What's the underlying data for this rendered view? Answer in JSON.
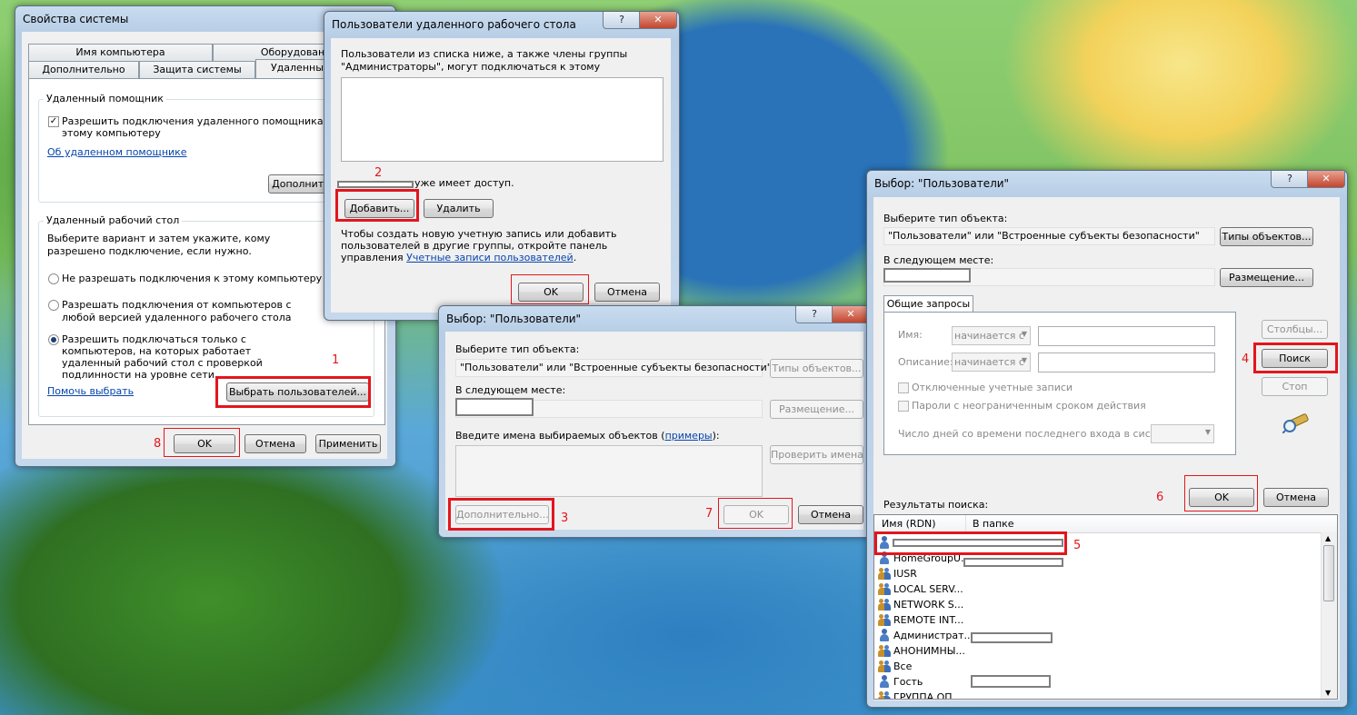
{
  "sys": {
    "title": "Свойства системы",
    "tabs_top": [
      "Имя компьютера",
      "Оборудование"
    ],
    "tabs_bottom": [
      "Дополнительно",
      "Защита системы",
      "Удаленный доступ"
    ],
    "assist_group": "Удаленный помощник",
    "assist_check": "Разрешить подключения удаленного помощника к этому компьютеру",
    "assist_link": "Об удаленном помощнике",
    "advanced_btn": "Дополнительно...",
    "desk_group": "Удаленный рабочий стол",
    "desk_desc": "Выберите вариант и затем укажите, кому разрешено подключение, если нужно.",
    "radio1": "Не разрешать подключения к этому компьютеру",
    "radio2": "Разрешать подключения от компьютеров с любой версией удаленного рабочего стола (опаснее)",
    "radio3": "Разрешить подключаться только с компьютеров, на которых работает удаленный рабочий стол с проверкой подлинности на уровне сети",
    "help_link": "Помочь выбрать",
    "select_users_btn": "Выбрать пользователей...",
    "ok": "OK",
    "cancel": "Отмена",
    "apply": "Применить"
  },
  "rdu": {
    "title": "Пользователи удаленного рабочего стола",
    "help_glyph": "?",
    "close_glyph": "✕",
    "desc": "Пользователи из списка ниже, а также члены группы \"Администраторы\", могут подключаться к этому компьютеру.",
    "access": "уже имеет доступ.",
    "add": "Добавить...",
    "remove": "Удалить",
    "hint": "Чтобы создать новую учетную запись или добавить пользователей в другие группы, откройте панель управления",
    "hint_link": "Учетные записи пользователей",
    "ok": "OK",
    "cancel": "Отмена"
  },
  "sel1": {
    "title": "Выбор: \"Пользователи\"",
    "obj_label": "Выберите тип объекта:",
    "obj_value": "\"Пользователи\" или \"Встроенные субъекты безопасности\"",
    "types_btn": "Типы объектов...",
    "loc_label": "В следующем месте:",
    "loc_btn": "Размещение...",
    "names_label": "Введите имена выбираемых объектов (",
    "names_link": "примеры",
    "names_label_end": "):",
    "check_btn": "Проверить имена",
    "advanced_btn": "Дополнительно...",
    "ok": "OK",
    "cancel": "Отмена"
  },
  "sel2": {
    "title": "Выбор: \"Пользователи\"",
    "obj_label": "Выберите тип объекта:",
    "obj_value": "\"Пользователи\" или \"Встроенные субъекты безопасности\"",
    "types_btn": "Типы объектов...",
    "loc_label": "В следующем месте:",
    "loc_btn": "Размещение...",
    "tab": "Общие запросы",
    "name_label": "Имя:",
    "desc_label": "Описание:",
    "starts_with": "начинается с",
    "disabled_check": "Отключенные учетные записи",
    "noexpire_check": "Пароли с неограниченным сроком действия",
    "days_label": "Число дней со времени последнего входа в систему:",
    "columns_btn": "Столбцы...",
    "search_btn": "Поиск",
    "stop_btn": "Стоп",
    "ok": "OK",
    "cancel": "Отмена",
    "results_label": "Результаты поиска:",
    "col_name": "Имя (RDN)",
    "col_folder": "В папке",
    "results": [
      "",
      "HomeGroupU...",
      "IUSR",
      "LOCAL SERV...",
      "NETWORK S...",
      "REMOTE INT...",
      "Администрат...",
      "АНОНИМНЫ...",
      "Все",
      "Гость",
      "ГРУППА ОП..."
    ]
  },
  "annotations": [
    "1",
    "2",
    "3",
    "4",
    "5",
    "6",
    "7",
    "8"
  ]
}
